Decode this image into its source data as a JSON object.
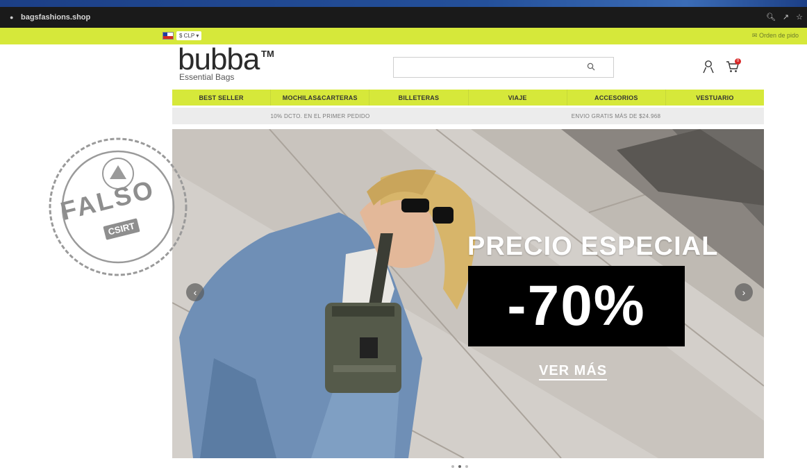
{
  "browser": {
    "url": "bagsfashions.shop"
  },
  "topbar": {
    "currency": "$ CLP",
    "orders_link": "Orden de pido"
  },
  "header": {
    "logo_word": "bubba",
    "logo_tm": "TM",
    "logo_tagline": "Essential Bags",
    "search_placeholder": "",
    "cart_count": "0"
  },
  "nav": {
    "items": [
      "BEST SELLER",
      "MOCHILAS&CARTERAS",
      "BILLETERAS",
      "VIAJE",
      "ACCESORIOS",
      "VESTUARIO"
    ]
  },
  "promo": {
    "left": "10% DCTO. EN EL PRIMER PEDIDO",
    "right": "ENVIO GRATIS MÁS DE $24.968"
  },
  "hero": {
    "headline": "PRECIO ESPECIAL",
    "discount": "-70%",
    "cta": "VER MÁS",
    "slides": 3,
    "active_slide": 2
  },
  "stamp": {
    "text": "FALSO",
    "sub": "CSIRT"
  },
  "colors": {
    "accent_yellow": "#d6e83a",
    "browser_dark": "#1a1a1a",
    "stamp_gray": "#8e8e8e"
  }
}
